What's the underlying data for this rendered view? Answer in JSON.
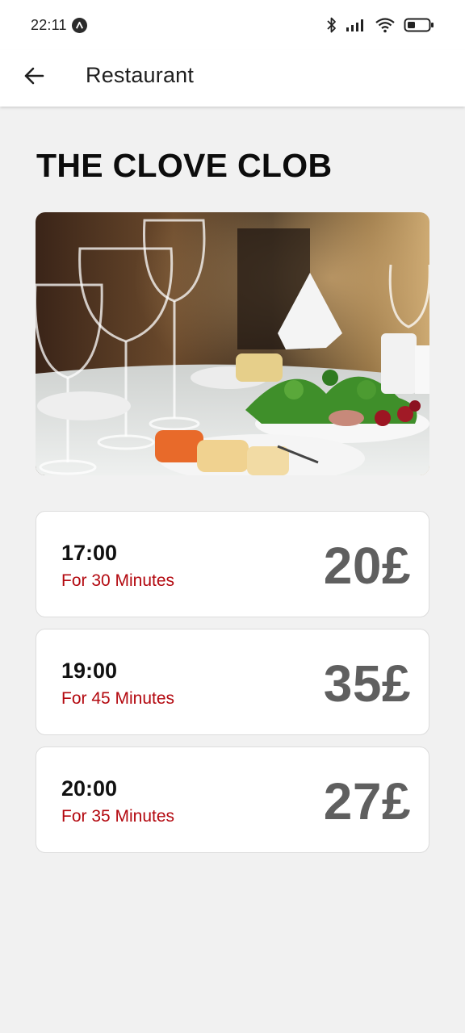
{
  "status_bar": {
    "time": "22:11",
    "notification_icon": "a-circle-icon",
    "icons": [
      "bluetooth-icon",
      "signal-icon",
      "wifi-icon",
      "battery-icon"
    ]
  },
  "app_bar": {
    "back_icon": "arrow-left-icon",
    "title": "Restaurant"
  },
  "restaurant": {
    "name": "THE CLOVE CLOB"
  },
  "slots": [
    {
      "time": "17:00",
      "duration": "For 30 Minutes",
      "price": "20£"
    },
    {
      "time": "19:00",
      "duration": "For 45 Minutes",
      "price": "35£"
    },
    {
      "time": "20:00",
      "duration": "For 35 Minutes",
      "price": "27£"
    }
  ],
  "colors": {
    "accent_red": "#b3080f",
    "price_gray": "#5f5f5f",
    "background": "#f1f1f1"
  }
}
